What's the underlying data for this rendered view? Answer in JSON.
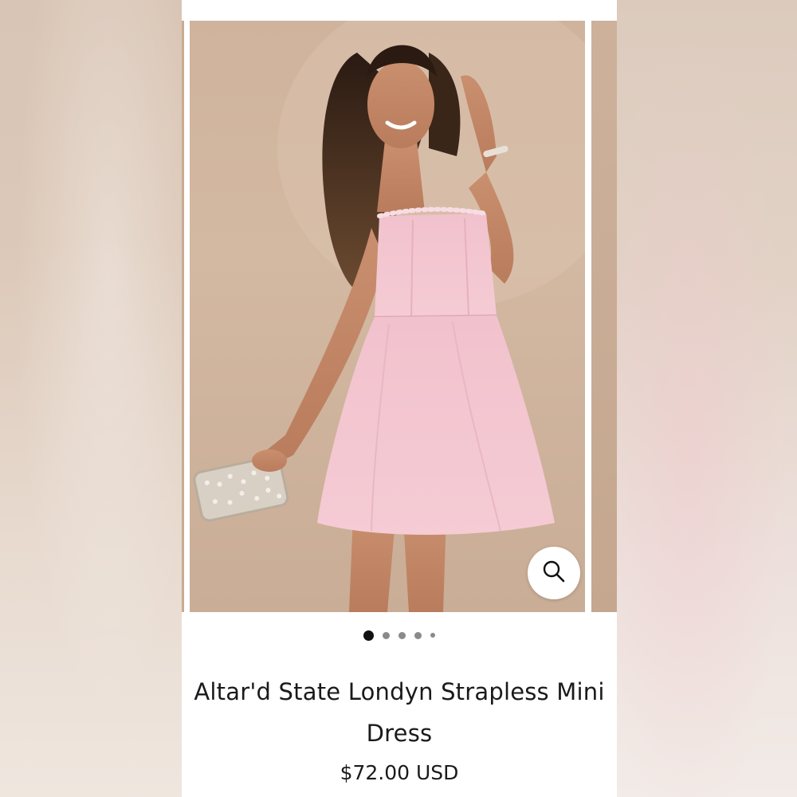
{
  "product": {
    "title": "Altar'd State Londyn Strapless Mini Dress",
    "price": "$72.00 USD",
    "image_alt": "Model wearing pink strapless mini dress holding a sparkly clutch"
  },
  "gallery": {
    "total_dots": 5,
    "active_index": 0
  },
  "icons": {
    "zoom": "search-icon"
  },
  "colors": {
    "dress": "#f3c4cf",
    "backdrop": "#cfb39d",
    "active_dot": "#111111"
  }
}
